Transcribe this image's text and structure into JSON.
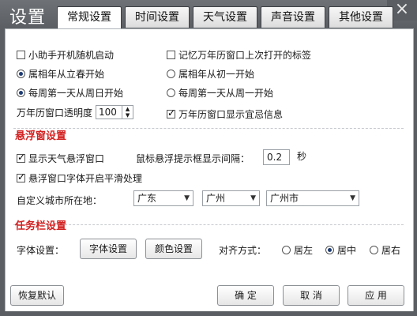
{
  "window": {
    "title": "设置",
    "close_icon": "×"
  },
  "tabs": [
    {
      "label": "常规设置",
      "active": true
    },
    {
      "label": "时间设置",
      "active": false
    },
    {
      "label": "天气设置",
      "active": false
    },
    {
      "label": "声音设置",
      "active": false
    },
    {
      "label": "其他设置",
      "active": false
    }
  ],
  "general": {
    "startup": {
      "label": "小助手开机随机启动",
      "checked": false
    },
    "remember_tab": {
      "label": "记忆万年历窗口上次打开的标签",
      "checked": false
    },
    "year_lichun": {
      "label": "属相年从立春开始",
      "checked": true
    },
    "year_chuyi": {
      "label": "属相年从初一开始",
      "checked": false
    },
    "week_sunday": {
      "label": "每周第一天从周日开始",
      "checked": true
    },
    "week_monday": {
      "label": "每周第一天从周一开始",
      "checked": false
    },
    "opacity_label": "万年历窗口透明度",
    "opacity_value": "100",
    "show_yiji": {
      "label": "万年历窗口显示宜忌信息",
      "checked": true
    }
  },
  "float_window": {
    "section_title": "悬浮窗设置",
    "show_weather": {
      "label": "显示天气悬浮窗口",
      "checked": true
    },
    "hover_label": "鼠标悬浮提示框显示间隔：",
    "hover_value": "0.2",
    "hover_unit": "秒",
    "smooth_font": {
      "label": "悬浮窗口字体开启平滑处理",
      "checked": true
    },
    "city_label": "自定义城市所在地：",
    "province": "广东",
    "city": "广州",
    "district": "广州市"
  },
  "taskbar": {
    "section_title": "任务栏设置",
    "font_label": "字体设置：",
    "font_button": "字体设置",
    "color_button": "颜色设置",
    "align_label": "对齐方式：",
    "align_left": {
      "label": "居左",
      "checked": false
    },
    "align_center": {
      "label": "居中",
      "checked": true
    },
    "align_right": {
      "label": "居右",
      "checked": false
    }
  },
  "footer": {
    "restore_button": "恢复默认",
    "ok_button": "确 定",
    "cancel_button": "取 消",
    "apply_button": "应 用"
  }
}
